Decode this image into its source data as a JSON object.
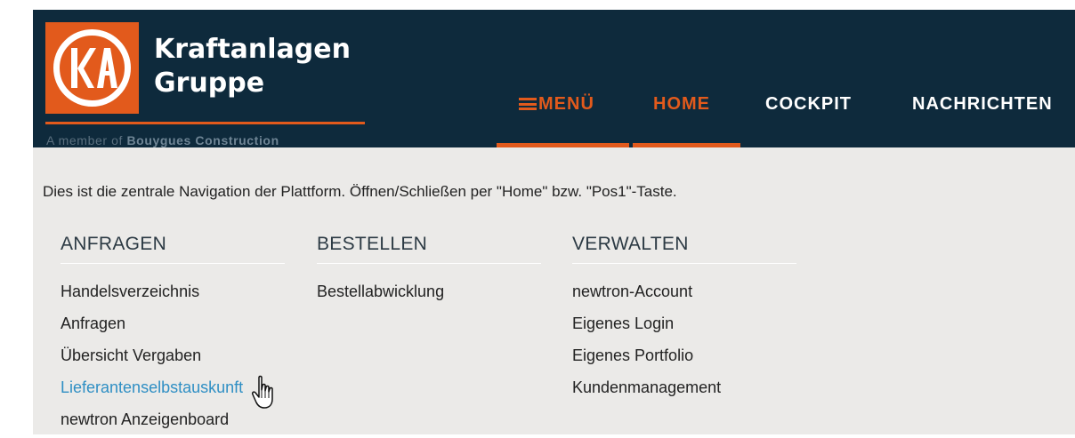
{
  "header": {
    "brand_line1": "Kraftanlagen",
    "brand_line2": "Gruppe",
    "logo_text": "KA",
    "tagline_prefix": "A member of ",
    "tagline_company": "Bouygues Construction",
    "colors": {
      "background": "#0e2a3c",
      "accent": "#e25a1c"
    }
  },
  "nav": {
    "menu_label": "MENÜ",
    "home_label": "HOME",
    "cockpit_label": "COCKPIT",
    "news_label": "NACHRICHTEN"
  },
  "panel": {
    "intro": "Dies ist die zentrale Navigation der Plattform. Öffnen/Schließen per \"Home\" bzw. \"Pos1\"-Taste.",
    "columns": [
      {
        "title": "ANFRAGEN",
        "links": [
          "Handelsverzeichnis",
          "Anfragen",
          "Übersicht Vergaben",
          "Lieferantenselbstauskunft",
          "newtron Anzeigenboard"
        ]
      },
      {
        "title": "BESTELLEN",
        "links": [
          "Bestellabwicklung"
        ]
      },
      {
        "title": "VERWALTEN",
        "links": [
          "newtron-Account",
          "Eigenes Login",
          "Eigenes Portfolio",
          "Kundenmanagement"
        ]
      }
    ],
    "hovered_link": "Lieferantenselbstauskunft",
    "link_hover_color": "#2f8fc4"
  }
}
